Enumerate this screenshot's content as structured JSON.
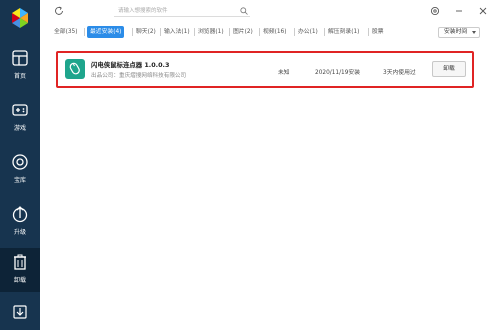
{
  "sidebar": {
    "items": [
      {
        "label": "首页",
        "icon": "home-icon"
      },
      {
        "label": "游戏",
        "icon": "gamepad-icon"
      },
      {
        "label": "宝库",
        "icon": "treasure-icon"
      },
      {
        "label": "升级",
        "icon": "upgrade-icon"
      },
      {
        "label": "卸载",
        "icon": "trash-icon"
      }
    ],
    "active_index": 4,
    "bottom_icon": "download-icon"
  },
  "search": {
    "placeholder": "请输入想搜索的软件"
  },
  "tabs": [
    {
      "label": "全部(35)"
    },
    {
      "label": "最近安装(4)",
      "active": true
    },
    {
      "label": "聊天(2)"
    },
    {
      "label": "输入法(1)"
    },
    {
      "label": "浏览器(1)"
    },
    {
      "label": "图片(2)"
    },
    {
      "label": "视频(16)"
    },
    {
      "label": "办公(1)"
    },
    {
      "label": "解压刻录(1)"
    },
    {
      "label": "股票"
    }
  ],
  "sort": {
    "label": "安装时间"
  },
  "app": {
    "name": "闪电侠鼠标连点器 1.0.0.3",
    "company": "出品公司：重庆熠搜网络科技有限公司",
    "size": "未知",
    "install_date": "2020/11/19安装",
    "usage": "3天内使用过",
    "uninstall_label": "卸载"
  },
  "colors": {
    "sidebar_bg": "#17344f",
    "accent": "#2b8ce8",
    "highlight_border": "#e02424",
    "app_icon": "#1ea58c"
  }
}
